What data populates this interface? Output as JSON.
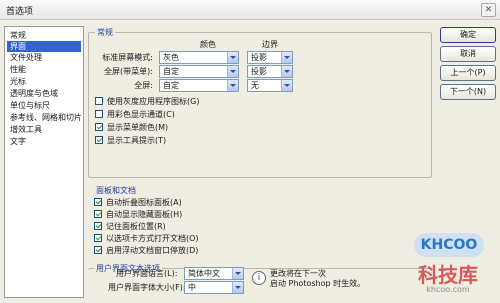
{
  "window": {
    "title": "首选项",
    "close_glyph": "✕"
  },
  "nav": {
    "items": [
      {
        "label": "常规",
        "selected": false
      },
      {
        "label": "界面",
        "selected": true
      },
      {
        "label": "文件处理",
        "selected": false
      },
      {
        "label": "性能",
        "selected": false
      },
      {
        "label": "光标",
        "selected": false
      },
      {
        "label": "透明度与色域",
        "selected": false
      },
      {
        "label": "单位与标尺",
        "selected": false
      },
      {
        "label": "参考线、网格和切片",
        "selected": false
      },
      {
        "label": "增效工具",
        "selected": false
      },
      {
        "label": "文字",
        "selected": false
      }
    ]
  },
  "general": {
    "title": "常规",
    "col_color": "颜色",
    "col_border": "边界",
    "rows": [
      {
        "label": "标准屏幕模式:",
        "color": "灰色",
        "border": "投影"
      },
      {
        "label": "全屏(带菜单):",
        "color": "自定",
        "border": "投影"
      },
      {
        "label": "全屏:",
        "color": "自定",
        "border": "无"
      }
    ],
    "checks": [
      {
        "label": "使用灰度应用程序图标(G)",
        "checked": false
      },
      {
        "label": "用彩色显示通道(C)",
        "checked": false
      },
      {
        "label": "显示菜单颜色(M)",
        "checked": true
      },
      {
        "label": "显示工具提示(T)",
        "checked": true
      }
    ]
  },
  "panels": {
    "title": "面板和文档",
    "checks": [
      {
        "label": "自动折叠图标面板(A)",
        "checked": true
      },
      {
        "label": "自动显示隐藏面板(H)",
        "checked": true
      },
      {
        "label": "记住面板位置(R)",
        "checked": true
      },
      {
        "label": "以选项卡方式打开文档(O)",
        "checked": true
      },
      {
        "label": "启用浮动文档窗口停放(D)",
        "checked": true
      }
    ]
  },
  "ui_text": {
    "title": "用户界面文本选项",
    "language_label": "用户界面语言(L):",
    "language_value": "简体中文",
    "font_size_label": "用户界面字体大小(F):",
    "font_size_value": "中",
    "note_line1": "更改将在下一次",
    "note_line2": "启动 Photoshop 时生效。",
    "info_glyph": "i"
  },
  "buttons": {
    "ok": "确定",
    "cancel": "取消",
    "prev": "上一个(P)",
    "next": "下一个(N)"
  },
  "watermark": {
    "badge": "KHCOO",
    "name": "科技库",
    "url": "khcoo.com"
  }
}
